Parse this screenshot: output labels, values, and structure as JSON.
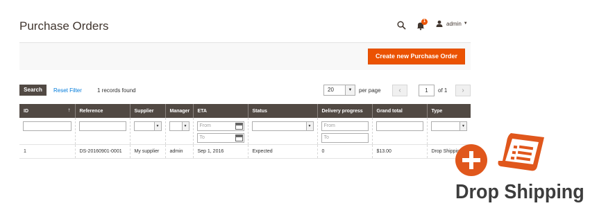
{
  "header": {
    "title": "Purchase Orders",
    "notifications_count": "1",
    "user_name": "admin",
    "icons": [
      "search-icon",
      "bell-icon",
      "user-icon",
      "caret-down-icon"
    ]
  },
  "actions": {
    "create_label": "Create new Purchase Order"
  },
  "toolbar": {
    "search_label": "Search",
    "reset_label": "Reset Filter",
    "records_text": "1 records found",
    "per_page_value": "20",
    "per_page_label": "per page",
    "page_value": "1",
    "page_of": "of 1"
  },
  "grid": {
    "columns": [
      "ID",
      "Reference",
      "Supplier",
      "Manager",
      "ETA",
      "Status",
      "Delivery progress",
      "Grand total",
      "Type"
    ],
    "filters": {
      "eta_from_placeholder": "From",
      "eta_to_placeholder": "To",
      "delivery_from_placeholder": "From",
      "delivery_to_placeholder": "To"
    },
    "rows": [
      {
        "id": "1",
        "reference": "DS-20160901-0001",
        "supplier": "My supplier",
        "manager": "admin",
        "eta": "Sep 1, 2016",
        "status": "Expected",
        "delivery": "0",
        "total": "$13.00",
        "type": "Drop Shipping"
      }
    ]
  },
  "branding": {
    "label": "Drop Shipping",
    "accent_color": "#e0571c",
    "icons": [
      "plus-icon",
      "document-icon"
    ]
  },
  "colors": {
    "accent": "#eb5202",
    "header_bg": "#514943",
    "link": "#007bdb"
  }
}
